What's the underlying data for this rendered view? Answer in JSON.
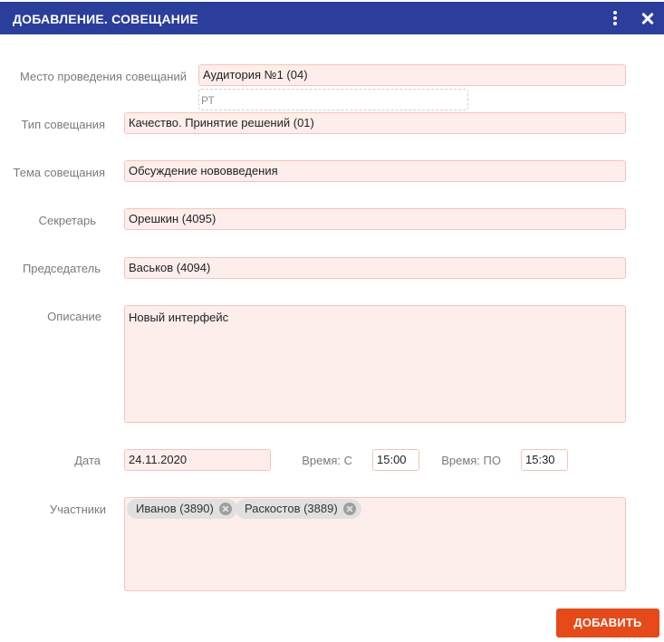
{
  "dialog": {
    "title": "ДОБАВЛЕНИЕ. СОВЕЩАНИЕ",
    "menu_icon": "more-vertical-icon",
    "close_icon": "close-icon"
  },
  "form": {
    "place": {
      "label": "Место проведения совещаний",
      "value": "Аудитория №1 (04)",
      "suggestion": "РТ"
    },
    "type": {
      "label": "Тип совещания",
      "value": "Качество. Принятие решений (01)"
    },
    "topic": {
      "label": "Тема совещания",
      "value": "Обсуждение нововведения"
    },
    "secretary": {
      "label": "Секретарь",
      "value": "Орешкин (4095)"
    },
    "chairman": {
      "label": "Председатель",
      "value": "Васьков (4094)"
    },
    "description": {
      "label": "Описание",
      "value": "Новый интерфейс"
    },
    "date": {
      "label": "Дата",
      "value": "24.11.2020"
    },
    "time_from": {
      "label": "Время: С",
      "value": "15:00"
    },
    "time_to": {
      "label": "Время: ПО",
      "value": "15:30"
    },
    "participants": {
      "label": "Участники",
      "items": [
        {
          "name": "Иванов (3890)"
        },
        {
          "name": "Раскостов (3889)"
        }
      ]
    }
  },
  "actions": {
    "add_label": "ДОБАВИТЬ"
  },
  "colors": {
    "header": "#2c3e9c",
    "field_bg": "#fdeeeb",
    "field_border": "#f3c5bc",
    "primary_button": "#e64a19"
  }
}
